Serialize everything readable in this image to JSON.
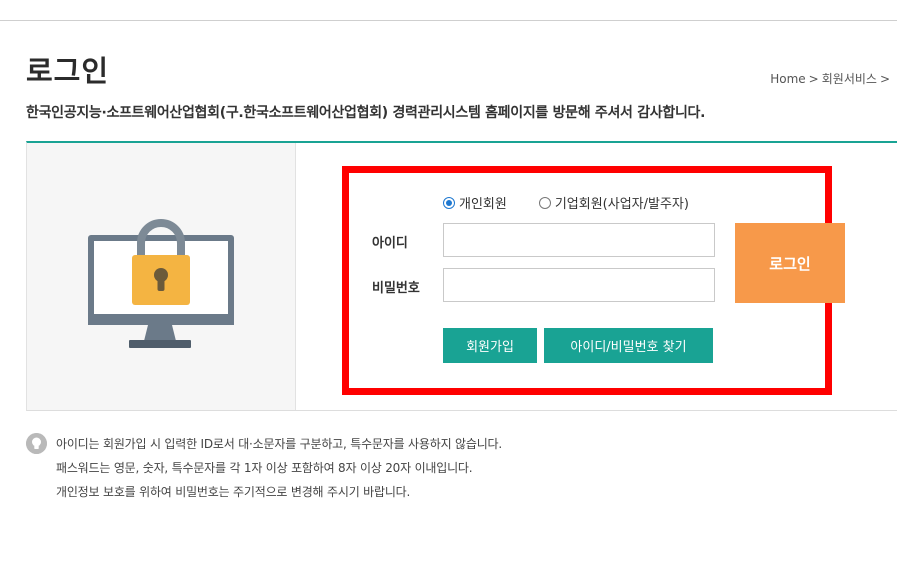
{
  "page": {
    "title": "로그인",
    "intro": "한국인공지능·소프트웨어산업협회(구.한국소프트웨어산업협회) 경력관리시스템 홈페이지를 방문해 주셔서 감사합니다."
  },
  "breadcrumb": {
    "home": "Home",
    "section": "회원서비스",
    "separator": ">"
  },
  "login": {
    "member_types": [
      {
        "label": "개인회원",
        "selected": true
      },
      {
        "label": "기업회원(사업자/발주자)",
        "selected": false
      }
    ],
    "id_label": "아이디",
    "id_value": "",
    "password_label": "비밀번호",
    "password_value": "",
    "login_button": "로그인",
    "signup_button": "회원가입",
    "find_button": "아이디/비밀번호 찾기"
  },
  "notes": [
    "아이디는 회원가입 시 입력한 ID로서 대·소문자를 구분하고, 특수문자를 사용하지 않습니다.",
    "패스워드는 영문, 숫자, 특수문자를 각 1자 이상 포함하여 8자 이상 20자 이내입니다.",
    "개인정보 보호를 위하여 비밀번호는 주기적으로 변경해 주시기 바랍니다."
  ],
  "colors": {
    "accent_teal": "#19a394",
    "login_orange": "#f7994a",
    "highlight_red": "#ff0000",
    "lock_yellow": "#f4b442",
    "monitor_gray": "#6b7a89"
  },
  "icons": [
    "lock-monitor-illustration",
    "lightbulb-icon",
    "radio-icon"
  ]
}
